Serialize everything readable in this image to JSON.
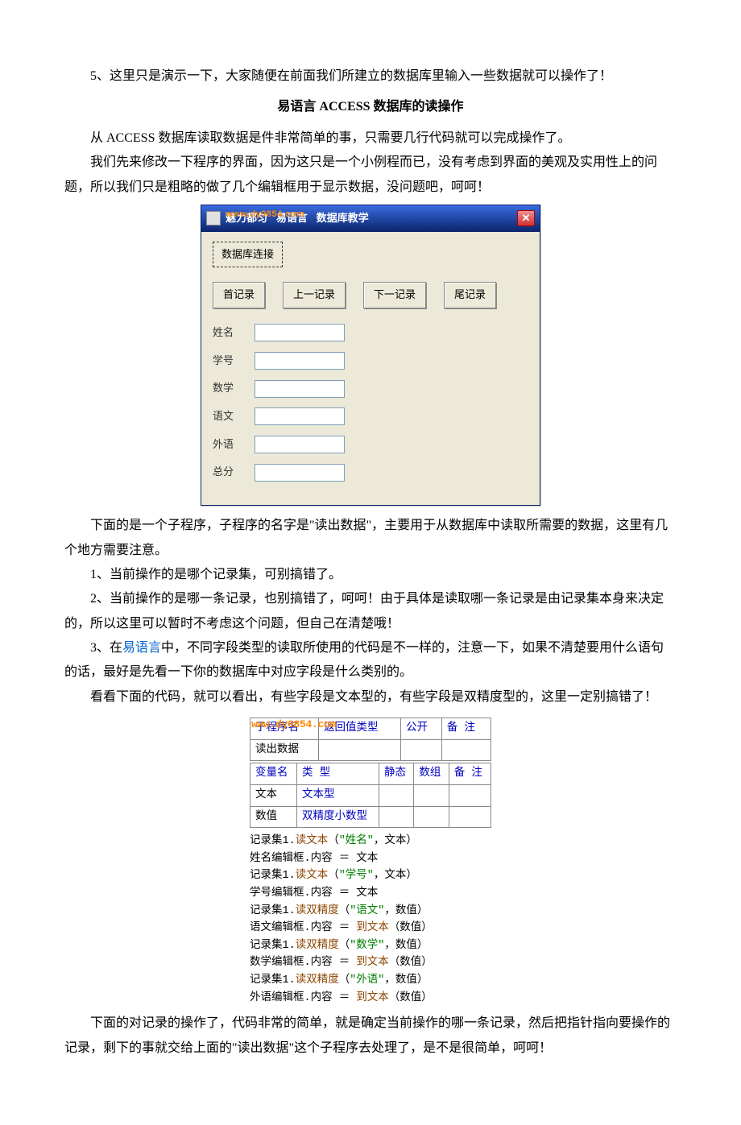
{
  "p1": "5、这里只是演示一下，大家随便在前面我们所建立的数据库里输入一些数据就可以操作了！",
  "heading": "易语言 ACCESS 数据库的读操作",
  "p2": "从 ACCESS 数据库读取数据是件非常简单的事，只需要几行代码就可以完成操作了。",
  "p3": "我们先来修改一下程序的界面，因为这只是一个小例程而已，没有考虑到界面的美观及实用性上的问题，所以我们只是粗略的做了几个编辑框用于显示数据，没问题吧，呵呵！",
  "win": {
    "title_prefix": "魅力都匀",
    "title_mid": "易语言",
    "title_suffix": "数据库教学",
    "connect": "数据库连接",
    "nav": [
      "首记录",
      "上一记录",
      "下一记录",
      "尾记录"
    ],
    "labels": [
      "姓名",
      "学号",
      "数学",
      "语文",
      "外语",
      "总分"
    ],
    "watermark": "www.dy0854.com"
  },
  "p4a": "下面的是一个子程序，子程序的名字是",
  "p4q": "读出数据",
  "p4b": "，主要用于从数据库中读取所需要的数据，这里有几个地方需要注意。",
  "p5": "1、当前操作的是哪个记录集，可别搞错了。",
  "p6": "2、当前操作的是哪一条记录，也别搞错了，呵呵！由于具体是读取哪一条记录是由记录集本身来决定的，所以这里可以暂时不考虑这个问题，但自己在清楚哦！",
  "p7a": "3、在",
  "p7link": "易语言",
  "p7b": "中，不同字段类型的读取所使用的代码是不一样的，注意一下，如果不清楚要用什么语句的话，最好是先看一下你的数据库中对应字段是什么类别的。",
  "p8": "看看下面的代码，就可以看出，有些字段是文本型的，有些字段是双精度型的，这里一定别搞错了！",
  "table1": {
    "headers": [
      "子程序名",
      "返回值类型",
      "公开",
      "备 注"
    ],
    "row": [
      "读出数据",
      "",
      "",
      ""
    ]
  },
  "table2": {
    "headers": [
      "变量名",
      "类 型",
      "静态",
      "数组",
      "备 注"
    ],
    "rows": [
      [
        "文本",
        "文本型",
        "",
        "",
        ""
      ],
      [
        "数值",
        "双精度小数型",
        "",
        "",
        ""
      ]
    ]
  },
  "code": {
    "l1": {
      "a": "记录集1.",
      "m": "读文本",
      "b": "（",
      "s": "\"姓名\"",
      "c": "，文本）"
    },
    "l2": "姓名编辑框.内容 ＝ 文本",
    "l3": {
      "a": "记录集1.",
      "m": "读文本",
      "b": "（",
      "s": "\"学号\"",
      "c": "，文本）"
    },
    "l4": "学号编辑框.内容 ＝ 文本",
    "l5": {
      "a": "记录集1.",
      "m": "读双精度",
      "b": "（",
      "s": "\"语文\"",
      "c": "，数值）"
    },
    "l6": {
      "a": "语文编辑框.内容 ＝ ",
      "m": "到文本",
      "b": "（数值）"
    },
    "l7": {
      "a": "记录集1.",
      "m": "读双精度",
      "b": "（",
      "s": "\"数学\"",
      "c": "，数值）"
    },
    "l8": {
      "a": "数学编辑框.内容 ＝ ",
      "m": "到文本",
      "b": "（数值）"
    },
    "l9": {
      "a": "记录集1.",
      "m": "读双精度",
      "b": "（",
      "s": "\"外语\"",
      "c": "，数值）"
    },
    "l10": {
      "a": "外语编辑框.内容 ＝ ",
      "m": "到文本",
      "b": "（数值）"
    }
  },
  "p9a": "下面的对记录的操作了，代码非常的简单，就是确定当前操作的哪一条记录，然后把指针指向要操作的记录，剩下的事就交给上面的",
  "p9q": "读出数据",
  "p9b": "这个子程序去处理了，是不是很简单，呵呵！"
}
